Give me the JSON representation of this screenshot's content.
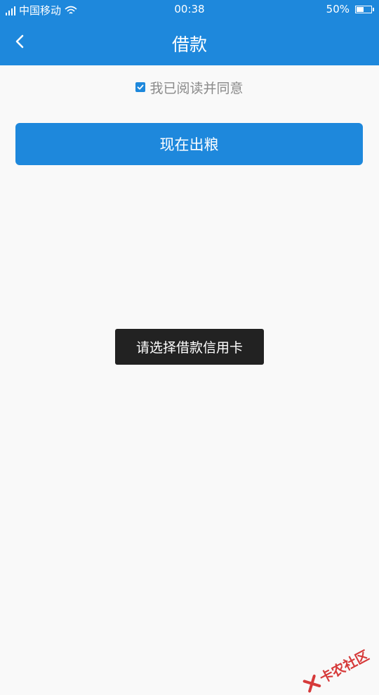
{
  "status_bar": {
    "carrier": "中国移动",
    "time": "00:38",
    "battery_text": "50%",
    "battery_level": 0.5,
    "icons": [
      "signal-icon",
      "wifi-icon",
      "battery-icon"
    ]
  },
  "nav": {
    "title": "借款",
    "back_icon": "chevron-left-icon"
  },
  "agreement": {
    "checked": true,
    "text": "我已阅读并同意"
  },
  "primary_button": {
    "label": "现在出粮"
  },
  "toast": {
    "message": "请选择借款信用卡"
  },
  "watermark": {
    "text": "卡农社区"
  },
  "colors": {
    "brand": "#1e88dc",
    "toast_bg": "#222222",
    "watermark": "#d63a3a",
    "background": "#f9f9f9"
  }
}
